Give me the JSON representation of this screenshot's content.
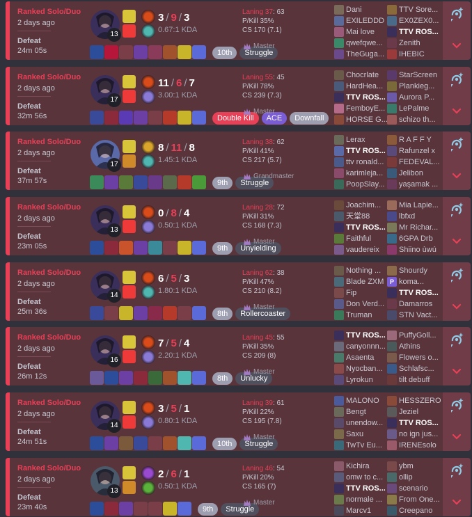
{
  "app": {
    "accent": "#e84057",
    "row_bg": "#59343b"
  },
  "matches": [
    {
      "queue": "Ranked Solo/Duo",
      "ago": "2 days ago",
      "result": "Defeat",
      "duration": "24m 05s",
      "champion": "Ahri",
      "champ_color": "#3a2f5a",
      "level": "13",
      "spells": [
        "#d9c53a",
        "#ef3a3a"
      ],
      "runes": [
        "#d94c1a",
        "#4fb7b0"
      ],
      "kills": "3",
      "deaths": "9",
      "assists": "3",
      "kda_ratio": "0.67:1 KDA",
      "laning_label": "Laning 37",
      "laning_rest": ": 63",
      "pkill": "P/Kill 35%",
      "cs": "CS 170 (7.1)",
      "rank": "Master",
      "items": [
        "#2b4d9a",
        "#b5163a",
        "#7a3e48",
        "#6b3fa3",
        "#8a3b5a",
        "#a0522d",
        "#c9b52a",
        "#5a6ad8"
      ],
      "badges": [
        {
          "text": "10th",
          "style": "grey"
        },
        {
          "text": "Struggle",
          "style": "dark"
        }
      ],
      "blue_team": [
        {
          "name": "Dani",
          "c": "#7a6a5a"
        },
        {
          "name": "EXILEDDD",
          "c": "#5a6a9a"
        },
        {
          "name": "Mai love",
          "c": "#9a5a7a"
        },
        {
          "name": "qwefqwe...",
          "c": "#3a8a6a"
        },
        {
          "name": "TheGuga...",
          "c": "#6a4a8a"
        }
      ],
      "red_team": [
        {
          "name": "TTV Sore...",
          "c": "#8a6a3a"
        },
        {
          "name": "EX0ZEX0...",
          "c": "#4a6a8a"
        },
        {
          "name": "TTV ROS...",
          "c": "#3a2f5a",
          "me": true
        },
        {
          "name": "Zenith",
          "c": "#6a3a4a"
        },
        {
          "name": "IHEBIC",
          "c": "#9a3a3a"
        }
      ]
    },
    {
      "queue": "Ranked Solo/Duo",
      "ago": "2 days ago",
      "result": "Defeat",
      "duration": "32m 56s",
      "champion": "Ahri",
      "champ_color": "#3a2f5a",
      "level": "17",
      "spells": [
        "#d9c53a",
        "#ef3a3a"
      ],
      "runes": [
        "#d94c1a",
        "#8a7ad8"
      ],
      "kills": "11",
      "deaths": "6",
      "assists": "7",
      "kda_ratio": "3.00:1 KDA",
      "laning_label": "Laning 55",
      "laning_rest": ": 45",
      "pkill": "P/Kill 78%",
      "cs": "CS 239 (7.3)",
      "rank": "Master",
      "items": [
        "#3a4a9a",
        "#8a2a3a",
        "#5a3ab5",
        "#6b3fa3",
        "#7a3e48",
        "#b53a2a",
        "#c9b52a",
        "#5a6ad8"
      ],
      "badges": [
        {
          "text": "Double Kill",
          "style": "red"
        },
        {
          "text": "ACE",
          "style": "purple"
        },
        {
          "text": "Downfall",
          "style": "grey"
        }
      ],
      "blue_team": [
        {
          "name": "Chocrlate",
          "c": "#6a5a4a"
        },
        {
          "name": "HardHea...",
          "c": "#4a5a7a"
        },
        {
          "name": "TTV ROS...",
          "c": "#3a2f5a",
          "me": true
        },
        {
          "name": "FemboyE...",
          "c": "#b56a8a"
        },
        {
          "name": "HORSE G...",
          "c": "#8a4a3a"
        }
      ],
      "red_team": [
        {
          "name": "StarScreen",
          "c": "#5a3a6a"
        },
        {
          "name": "Plankieg...",
          "c": "#7a6a3a"
        },
        {
          "name": "Aurora P...",
          "c": "#6a5aa8"
        },
        {
          "name": "LePalme",
          "c": "#3a7a6a"
        },
        {
          "name": "schizo th...",
          "c": "#9a5a5a"
        }
      ]
    },
    {
      "queue": "Ranked Solo/Duo",
      "ago": "2 days ago",
      "result": "Defeat",
      "duration": "37m 57s",
      "champion": "Lux",
      "champ_color": "#5a6aa8",
      "level": "17",
      "spells": [
        "#d9c53a",
        "#d08a2a"
      ],
      "runes": [
        "#d9a52a",
        "#4fb7b0"
      ],
      "kills": "8",
      "deaths": "11",
      "assists": "8",
      "kda_ratio": "1.45:1 KDA",
      "laning_label": "Laning 38",
      "laning_rest": ": 62",
      "pkill": "P/Kill 41%",
      "cs": "CS 217 (5.7)",
      "rank": "Grandmaster",
      "items": [
        "#3a8a5a",
        "#6b3fa3",
        "#5a7a3a",
        "#3a4a9a",
        "#6a3a8a",
        "#5a6a4a",
        "#b53a2a",
        "#4a9a3a"
      ],
      "badges": [
        {
          "text": "9th",
          "style": "grey"
        },
        {
          "text": "Struggle",
          "style": "dark"
        }
      ],
      "blue_team": [
        {
          "name": "Lerax",
          "c": "#6a6a5a"
        },
        {
          "name": "TTV ROS...",
          "c": "#5a6aa8",
          "me": true
        },
        {
          "name": "ttv ronald...",
          "c": "#4a5a8a"
        },
        {
          "name": "karimleja...",
          "c": "#8a4a6a"
        },
        {
          "name": "PoopSlay...",
          "c": "#3a6a5a"
        }
      ],
      "red_team": [
        {
          "name": "R A F F Y",
          "c": "#8a5a3a"
        },
        {
          "name": "Rafunzel x",
          "c": "#5a4a7a"
        },
        {
          "name": "FEDEVAL...",
          "c": "#7a3a3a"
        },
        {
          "name": "Jelibon",
          "c": "#3a5a7a"
        },
        {
          "name": "yaşamak ...",
          "c": "#6a3a5a"
        }
      ]
    },
    {
      "queue": "Ranked Solo/Duo",
      "ago": "2 days ago",
      "result": "Defeat",
      "duration": "23m 05s",
      "champion": "Ahri",
      "champ_color": "#3a2f5a",
      "level": "13",
      "spells": [
        "#d9c53a",
        "#ef3a3a"
      ],
      "runes": [
        "#d94c1a",
        "#8a7ad8"
      ],
      "kills": "0",
      "deaths": "8",
      "assists": "4",
      "kda_ratio": "0.50:1 KDA",
      "laning_label": "Laning 28",
      "laning_rest": ": 72",
      "pkill": "P/Kill 31%",
      "cs": "CS 168 (7.3)",
      "rank": "Master",
      "items": [
        "#2b4d9a",
        "#8a2a3a",
        "#c9532a",
        "#6b3fa3",
        "#3a8a9a",
        "#7a3e48",
        "#c9b52a",
        "#5a6ad8"
      ],
      "badges": [
        {
          "text": "9th",
          "style": "grey"
        },
        {
          "text": "Unyielding",
          "style": "dark"
        }
      ],
      "blue_team": [
        {
          "name": "Joachim...",
          "c": "#6a4a3a"
        },
        {
          "name": "天堂88",
          "c": "#4a5a6a"
        },
        {
          "name": "TTV ROS...",
          "c": "#3a2f5a",
          "me": true
        },
        {
          "name": "Faithful",
          "c": "#5a7a3a"
        },
        {
          "name": "vaudereix",
          "c": "#7a5a8a"
        }
      ],
      "red_team": [
        {
          "name": "Mia Lapie...",
          "c": "#9a6a5a"
        },
        {
          "name": "lbfxd",
          "c": "#4a4a8a"
        },
        {
          "name": "Mr Richar...",
          "c": "#7a7a5a"
        },
        {
          "name": "6GPA Drb",
          "c": "#3a6a8a"
        },
        {
          "name": "Shiino ùwú",
          "c": "#8a3a6a"
        }
      ]
    },
    {
      "queue": "Ranked Solo/Duo",
      "ago": "2 days ago",
      "result": "Defeat",
      "duration": "25m 36s",
      "champion": "Ahri",
      "champ_color": "#3a2f5a",
      "level": "14",
      "spells": [
        "#d9c53a",
        "#ef3a3a"
      ],
      "runes": [
        "#d94c1a",
        "#4fb7b0"
      ],
      "kills": "6",
      "deaths": "5",
      "assists": "3",
      "kda_ratio": "1.80:1 KDA",
      "laning_label": "Laning 62",
      "laning_rest": ": 38",
      "pkill": "P/Kill 47%",
      "cs": "CS 210 (8.2)",
      "rank": "Master",
      "items": [
        "#3a4a9a",
        "#7a3e48",
        "#c9b52a",
        "#6b3fa3",
        "#8a2a4a",
        "#b53a2a",
        "#7a3e48",
        "#5a6ad8"
      ],
      "badges": [
        {
          "text": "8th",
          "style": "grey"
        },
        {
          "text": "Rollercoaster",
          "style": "dark"
        }
      ],
      "blue_team": [
        {
          "name": "Nothing ...",
          "c": "#6a5a4a"
        },
        {
          "name": "Blade ZXM",
          "c": "#4a6a7a"
        },
        {
          "name": "Fip",
          "c": "#7a4a4a"
        },
        {
          "name": "Don Verd...",
          "c": "#5a5a8a"
        },
        {
          "name": "Truman",
          "c": "#3a7a5a"
        }
      ],
      "red_team": [
        {
          "name": "Shourdy",
          "c": "#8a6a4a"
        },
        {
          "name": "koma...",
          "c": "#7a5cd5",
          "tag": "P"
        },
        {
          "name": "TTV ROS...",
          "c": "#3a2f5a",
          "me": true
        },
        {
          "name": "Damarros",
          "c": "#6a3a4a"
        },
        {
          "name": "STN Vact...",
          "c": "#4a4a6a"
        }
      ]
    },
    {
      "queue": "Ranked Solo/Duo",
      "ago": "2 days ago",
      "result": "Defeat",
      "duration": "26m 12s",
      "champion": "Ahri",
      "champ_color": "#3a2f5a",
      "level": "16",
      "spells": [
        "#d9c53a",
        "#ef3a3a"
      ],
      "runes": [
        "#d94c1a",
        "#8a7ad8"
      ],
      "kills": "7",
      "deaths": "5",
      "assists": "4",
      "kda_ratio": "2.20:1 KDA",
      "laning_label": "Laning 45",
      "laning_rest": ": 55",
      "pkill": "P/Kill 35%",
      "cs": "CS 209 (8)",
      "rank": "Master",
      "items": [
        "#6a5a9a",
        "#2b4d9a",
        "#6b3fa3",
        "#8a2a3a",
        "#3a6a3a",
        "#a0522d",
        "#4fb7b0",
        "#5a6ad8"
      ],
      "badges": [
        {
          "text": "8th",
          "style": "grey"
        },
        {
          "text": "Unlucky",
          "style": "dark"
        }
      ],
      "blue_team": [
        {
          "name": "TTV ROS...",
          "c": "#3a2f5a",
          "me": true
        },
        {
          "name": "canyonnn...",
          "c": "#6a6a7a"
        },
        {
          "name": "Asaenta",
          "c": "#4a7a6a"
        },
        {
          "name": "Nyocban...",
          "c": "#8a4a4a"
        },
        {
          "name": "Lyrokun",
          "c": "#5a4a7a"
        }
      ],
      "red_team": [
        {
          "name": "PuffyGoll...",
          "c": "#9a6a7a"
        },
        {
          "name": "Athins",
          "c": "#4a5a5a"
        },
        {
          "name": "Flowers o...",
          "c": "#7a5a4a"
        },
        {
          "name": "Schlafsc...",
          "c": "#3a5a8a"
        },
        {
          "name": "tilt debuff",
          "c": "#6a3a3a"
        }
      ]
    },
    {
      "queue": "Ranked Solo/Duo",
      "ago": "2 days ago",
      "result": "Defeat",
      "duration": "24m 51s",
      "champion": "Ahri",
      "champ_color": "#3a2f5a",
      "level": "14",
      "spells": [
        "#d9c53a",
        "#ef3a3a"
      ],
      "runes": [
        "#d94c1a",
        "#8a7ad8"
      ],
      "kills": "3",
      "deaths": "5",
      "assists": "1",
      "kda_ratio": "0.80:1 KDA",
      "laning_label": "Laning 39",
      "laning_rest": ": 61",
      "pkill": "P/Kill 22%",
      "cs": "CS 195 (7.8)",
      "rank": "Master",
      "items": [
        "#2b4d9a",
        "#6b3fa3",
        "#7a5a3a",
        "#3a4a9a",
        "#7a3e48",
        "#a0522d",
        "#4fb7b0",
        "#5a6ad8"
      ],
      "badges": [
        {
          "text": "10th",
          "style": "grey"
        },
        {
          "text": "Struggle",
          "style": "dark"
        }
      ],
      "blue_team": [
        {
          "name": "MALONO",
          "c": "#4a5a9a"
        },
        {
          "name": "Bengt",
          "c": "#6a6a5a"
        },
        {
          "name": "unendow...",
          "c": "#5a4a6a"
        },
        {
          "name": "Saxu",
          "c": "#7a6a4a"
        },
        {
          "name": "TwTv Eu...",
          "c": "#3a6a7a"
        }
      ],
      "red_team": [
        {
          "name": "HESSZERO",
          "c": "#8a4a3a"
        },
        {
          "name": "Jeziel",
          "c": "#5a5a5a"
        },
        {
          "name": "TTV ROS...",
          "c": "#3a2f5a",
          "me": true
        },
        {
          "name": "no ign jus...",
          "c": "#6a5a8a"
        },
        {
          "name": "IRENEsolo",
          "c": "#9a5a6a"
        }
      ]
    },
    {
      "queue": "Ranked Solo/Duo",
      "ago": "2 days ago",
      "result": "Defeat",
      "duration": "23m 40s",
      "champion": "Evelynn",
      "champ_color": "#4a5a6a",
      "level": "13",
      "spells": [
        "#d9c53a",
        "#d08a2a"
      ],
      "runes": [
        "#9a4ad0",
        "#5ab33a"
      ],
      "kills": "2",
      "deaths": "6",
      "assists": "1",
      "kda_ratio": "0.50:1 KDA",
      "laning_label": "Laning 46",
      "laning_rest": ": 54",
      "pkill": "P/Kill 20%",
      "cs": "CS 165 (7)",
      "rank": "Master",
      "items": [
        "#2b4d9a",
        "#8a2a3a",
        "#6b3fa3",
        "#7a3e48",
        "#7a3e48",
        "#c9b52a",
        "#5a6ad8"
      ],
      "badges": [
        {
          "text": "9th",
          "style": "grey"
        },
        {
          "text": "Struggle",
          "style": "dark"
        }
      ],
      "blue_team": [
        {
          "name": "Kichira",
          "c": "#8a5a6a"
        },
        {
          "name": "omw to c...",
          "c": "#5a5a7a"
        },
        {
          "name": "TTV ROS...",
          "c": "#3a2f5a",
          "me": true
        },
        {
          "name": "normale ...",
          "c": "#6a7a4a"
        },
        {
          "name": "Marcv1",
          "c": "#4a4a5a"
        }
      ],
      "red_team": [
        {
          "name": "ybm",
          "c": "#7a4a4a"
        },
        {
          "name": "ollip",
          "c": "#4a6a6a"
        },
        {
          "name": "scenario",
          "c": "#6a4a7a"
        },
        {
          "name": "From One...",
          "c": "#8a7a4a"
        },
        {
          "name": "Creepano",
          "c": "#3a5a6a"
        }
      ]
    }
  ]
}
